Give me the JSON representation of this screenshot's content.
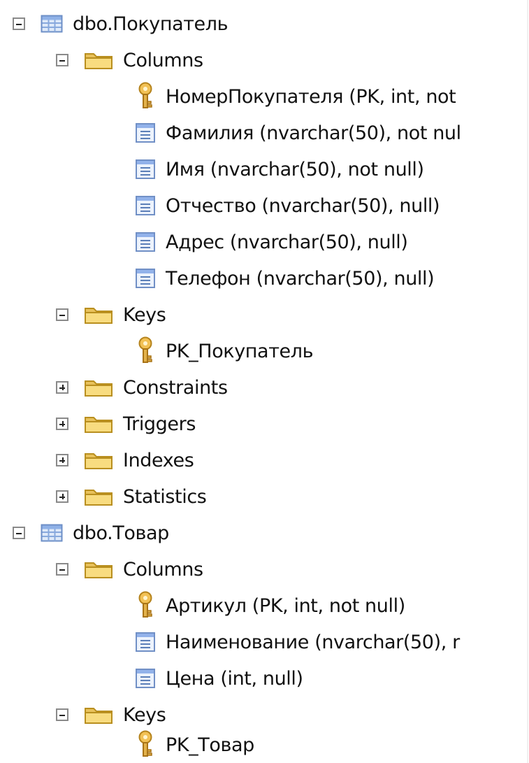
{
  "tree": {
    "nodes": [
      {
        "label": "dbo.Покупатель",
        "icon": "table-icon",
        "expanded": true
      },
      {
        "label": "Columns",
        "icon": "folder-icon",
        "expanded": true
      },
      {
        "label": "НомерПокупателя (PK, int, not",
        "icon": "key-icon"
      },
      {
        "label": "Фамилия (nvarchar(50), not nul",
        "icon": "column-icon"
      },
      {
        "label": "Имя (nvarchar(50), not null)",
        "icon": "column-icon"
      },
      {
        "label": "Отчество (nvarchar(50), null)",
        "icon": "column-icon"
      },
      {
        "label": "Адрес (nvarchar(50), null)",
        "icon": "column-icon"
      },
      {
        "label": "Телефон (nvarchar(50), null)",
        "icon": "column-icon"
      },
      {
        "label": "Keys",
        "icon": "folder-icon",
        "expanded": true
      },
      {
        "label": "PK_Покупатель",
        "icon": "key-icon"
      },
      {
        "label": "Constraints",
        "icon": "folder-icon",
        "expanded": false
      },
      {
        "label": "Triggers",
        "icon": "folder-icon",
        "expanded": false
      },
      {
        "label": "Indexes",
        "icon": "folder-icon",
        "expanded": false
      },
      {
        "label": "Statistics",
        "icon": "folder-icon",
        "expanded": false
      },
      {
        "label": "dbo.Товар",
        "icon": "table-icon",
        "expanded": true
      },
      {
        "label": "Columns",
        "icon": "folder-icon",
        "expanded": true
      },
      {
        "label": "Артикул (PK, int, not null)",
        "icon": "key-icon"
      },
      {
        "label": "Наименование (nvarchar(50), r",
        "icon": "column-icon"
      },
      {
        "label": "Цена (int, null)",
        "icon": "column-icon"
      },
      {
        "label": "Keys",
        "icon": "folder-icon",
        "expanded": true
      },
      {
        "label": "PK_Товар",
        "icon": "key-icon"
      }
    ]
  }
}
